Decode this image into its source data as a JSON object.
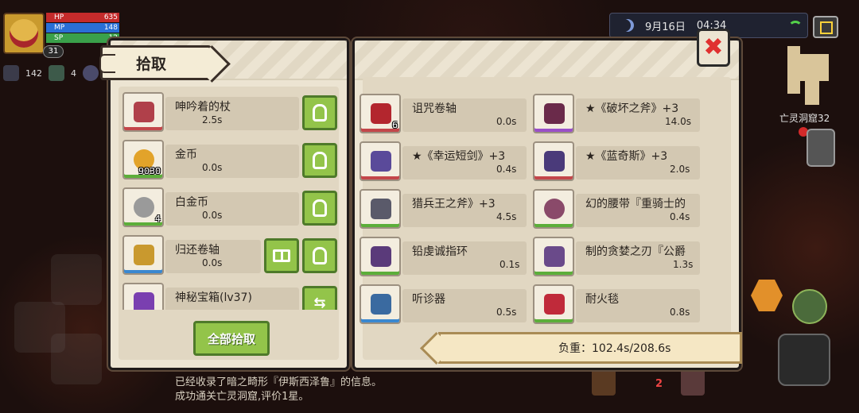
{
  "hud": {
    "hp_label": "HP",
    "hp_value": "635",
    "mp_label": "MP",
    "mp_value": "148",
    "sp_label": "SP",
    "sp_value": "12",
    "level": "31",
    "stat1": "142",
    "stat2": "4"
  },
  "status": {
    "date": "9月16日",
    "time": "04:34"
  },
  "dungeon": {
    "name": "亡灵洞窟32"
  },
  "panel": {
    "title": "拾取",
    "pick_all_label": "全部拾取",
    "weight_text": "负重：102.4s/208.6s"
  },
  "left_items": [
    {
      "name": "呻吟着的杖",
      "weight": "2.5s",
      "qty": "",
      "color": "#b0404a"
    },
    {
      "name": "金币",
      "weight": "0.0s",
      "qty": "9030",
      "color": "#e2a32a"
    },
    {
      "name": "白金币",
      "weight": "0.0s",
      "qty": "4",
      "color": "#9a9a9a"
    },
    {
      "name": "归还卷轴",
      "weight": "0.0s",
      "qty": "",
      "color": "#c9992e"
    },
    {
      "name": "神秘宝箱(lv37)",
      "weight": "",
      "qty": "",
      "color": "#7a3fb0"
    }
  ],
  "right_items": [
    {
      "name": "诅咒卷轴",
      "weight": "0.0s",
      "qty": "6",
      "color": "#b3262e"
    },
    {
      "name": "★《破坏之斧》+3",
      "weight": "14.0s",
      "qty": "",
      "color": "#6a2a4a"
    },
    {
      "name": "★《幸运短剑》+3",
      "weight": "0.4s",
      "qty": "",
      "color": "#5a4a9a"
    },
    {
      "name": "★《蓝奇斯》+3",
      "weight": "2.0s",
      "qty": "",
      "color": "#4a3a7a"
    },
    {
      "name": "猎兵王之斧》+3",
      "weight": "4.5s",
      "qty": "",
      "color": "#5a5a6a"
    },
    {
      "name": "幻的腰带『重骑士的",
      "weight": "0.4s",
      "qty": "",
      "color": "#8a4a6a"
    },
    {
      "name": "铅虔诚指环",
      "weight": "0.1s",
      "qty": "",
      "color": "#5a3a7a"
    },
    {
      "name": "制的贪婪之刃『公爵",
      "weight": "1.3s",
      "qty": "",
      "color": "#6a4a8a"
    },
    {
      "name": "听诊器",
      "weight": "0.5s",
      "qty": "",
      "color": "#3a6aa0"
    },
    {
      "name": "耐火毯",
      "weight": "0.8s",
      "qty": "",
      "color": "#c02a3a"
    }
  ],
  "messages": {
    "line1": "已经收录了暗之畸形『伊斯西泽鲁』的信息。",
    "line2": "成功通关亡灵洞窟,评价1星。"
  },
  "bottom": {
    "count": "2"
  },
  "colors": {
    "accent_green": "#93c44a",
    "panel_bg": "#ece4d2",
    "close_red": "#e03030"
  }
}
